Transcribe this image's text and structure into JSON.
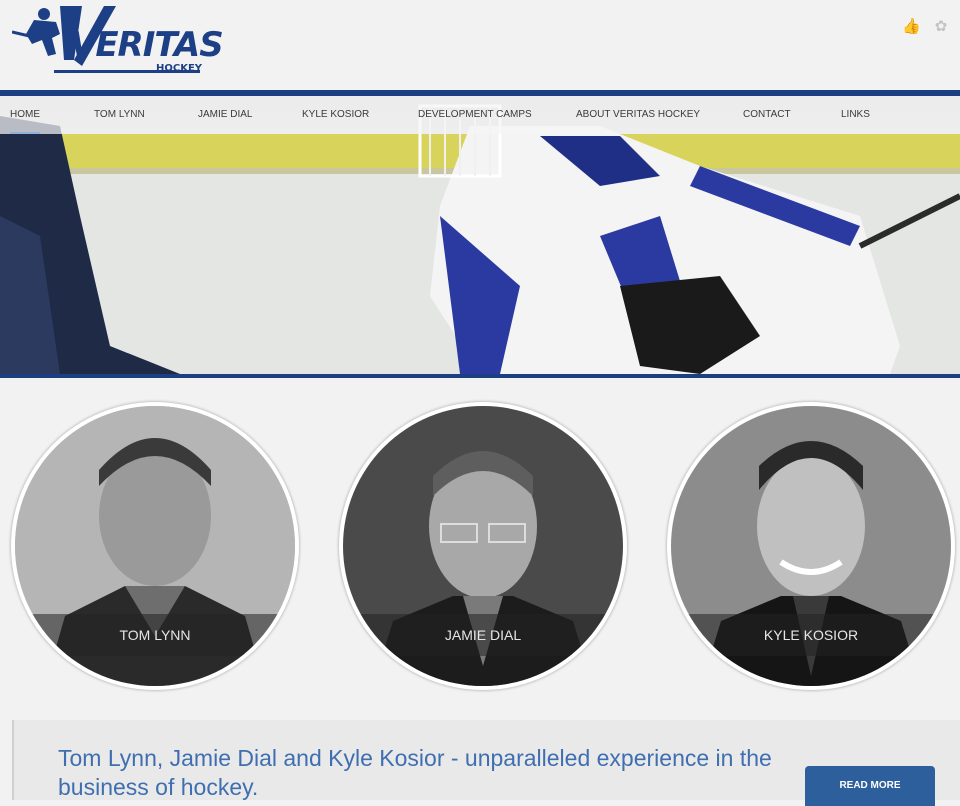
{
  "logo": {
    "word": "VERITAS",
    "sub": "HOCKEY"
  },
  "social": {
    "like_icon": "thumbs-up-icon",
    "twitter_icon": "twitter-bird-icon"
  },
  "nav": {
    "items": [
      {
        "label": "HOME",
        "active": true
      },
      {
        "label": "TOM LYNN"
      },
      {
        "label": "JAMIE DIAL"
      },
      {
        "label": "KYLE KOSIOR"
      },
      {
        "label": "DEVELOPMENT CAMPS"
      },
      {
        "label": "ABOUT VERITAS HOCKEY"
      },
      {
        "label": "CONTACT"
      },
      {
        "label": "LINKS"
      }
    ]
  },
  "profiles": [
    {
      "name": "TOM LYNN"
    },
    {
      "name": "JAMIE DIAL"
    },
    {
      "name": "KYLE KOSIOR"
    }
  ],
  "banner": {
    "text": "Tom Lynn, Jamie Dial and Kyle Kosior - unparalleled experience in the business of hockey.",
    "button": "READ MORE"
  },
  "colors": {
    "brand_blue": "#1d3f86",
    "link_blue": "#3f6fb0",
    "button_blue": "#2c5f9c"
  }
}
